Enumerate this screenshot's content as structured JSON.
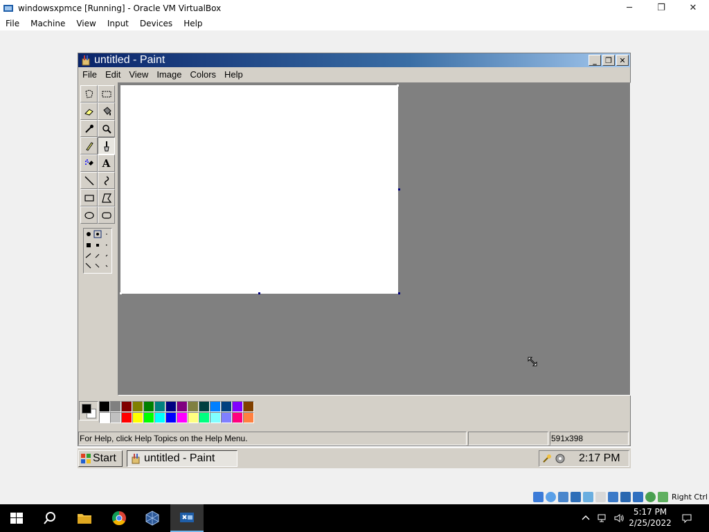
{
  "host": {
    "title": "windowsxpmce [Running] - Oracle VM VirtualBox",
    "menu": [
      "File",
      "Machine",
      "View",
      "Input",
      "Devices",
      "Help"
    ],
    "window_controls": {
      "minimize": "─",
      "maximize": "❐",
      "close": "✕"
    },
    "host_key": "Right Ctrl"
  },
  "paint": {
    "title": "untitled - Paint",
    "menu": [
      "File",
      "Edit",
      "View",
      "Image",
      "Colors",
      "Help"
    ],
    "controls": {
      "minimize": "_",
      "restore": "❐",
      "close": "✕"
    },
    "tools": [
      "free-select",
      "rect-select",
      "eraser",
      "fill",
      "color-picker",
      "magnifier",
      "pencil",
      "brush",
      "airbrush",
      "text",
      "line",
      "curve",
      "rectangle",
      "polygon",
      "ellipse",
      "rounded-rectangle"
    ],
    "active_tool": "brush",
    "text_tool_glyph": "A",
    "palette_top": [
      "#000000",
      "#808080",
      "#800000",
      "#808000",
      "#008000",
      "#008080",
      "#000080",
      "#800080",
      "#808040",
      "#004040",
      "#0080ff",
      "#004080",
      "#8000ff",
      "#804000"
    ],
    "palette_bottom": [
      "#ffffff",
      "#c0c0c0",
      "#ff0000",
      "#ffff00",
      "#00ff00",
      "#00ffff",
      "#0000ff",
      "#ff00ff",
      "#ffff80",
      "#00ff80",
      "#80ffff",
      "#8080ff",
      "#ff0080",
      "#ff8040"
    ],
    "foreground": "#000000",
    "background": "#ffffff",
    "status": {
      "help": "For Help, click Help Topics on the Help Menu.",
      "coords": "",
      "size": "591x398"
    }
  },
  "guest_taskbar": {
    "start_label": "Start",
    "task_label": "untitled - Paint",
    "clock": "2:17 PM"
  },
  "host_taskbar": {
    "time": "5:17 PM",
    "date": "2/25/2022"
  }
}
